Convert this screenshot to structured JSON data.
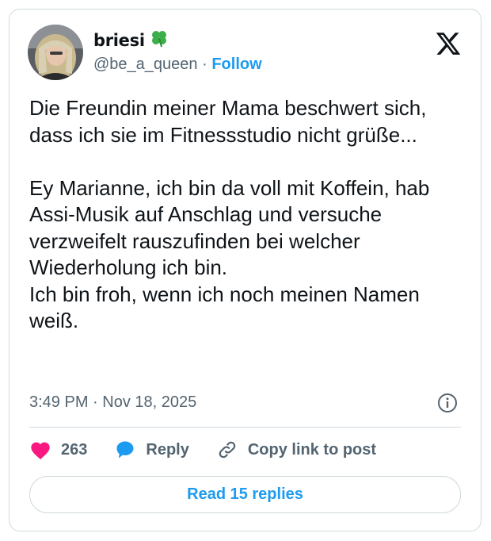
{
  "author": {
    "display_name": "briesi",
    "name_emoji": "four-leaf-clover-icon",
    "handle": "@be_a_queen",
    "separator": "·",
    "follow_label": "Follow"
  },
  "platform_icon": "x-logo-icon",
  "tweet": {
    "paragraphs": [
      "Die Freundin meiner Mama beschwert sich, dass ich sie im Fitnessstudio nicht grüße...",
      "Ey Marianne, ich bin da voll mit Koffein, hab Assi-Musik auf Anschlag und versuche verzweifelt rauszufinden bei welcher Wiederholung ich bin.\nIch bin froh, wenn ich noch meinen Namen weiß."
    ]
  },
  "meta": {
    "time": "3:49 PM",
    "separator": "·",
    "date": "Nov 18, 2025",
    "info_icon": "info-icon"
  },
  "actions": {
    "like_count": "263",
    "reply_label": "Reply",
    "copy_label": "Copy link to post"
  },
  "read_replies_label": "Read 15 replies",
  "colors": {
    "accent": "#1d9bf0",
    "like": "#f91880",
    "text": "#0f1419",
    "muted": "#536471",
    "border": "#cfd9de"
  }
}
